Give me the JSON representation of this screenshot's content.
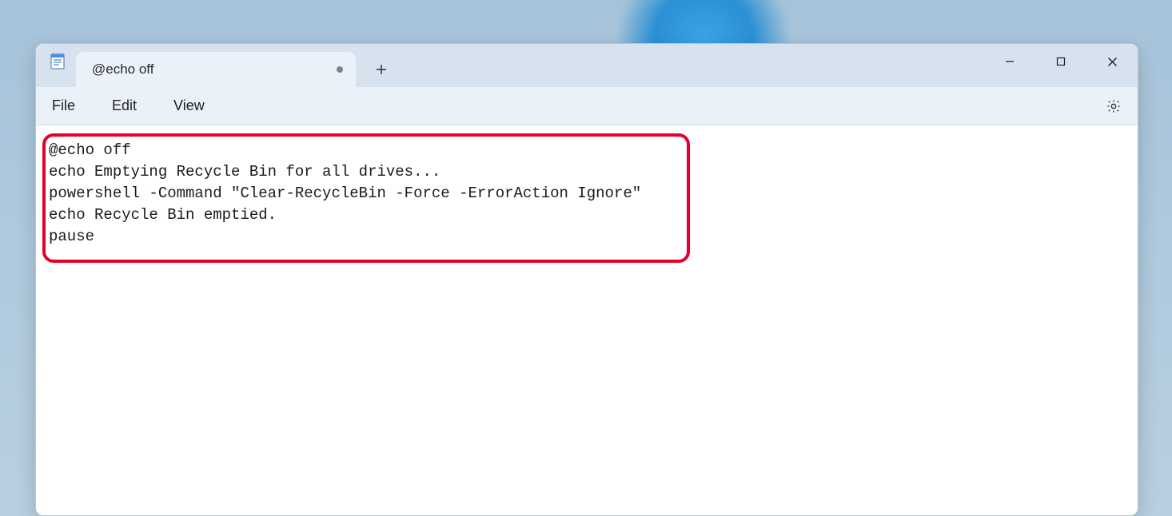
{
  "tab": {
    "title": "@echo off",
    "dirty": true
  },
  "menubar": {
    "file": "File",
    "edit": "Edit",
    "view": "View"
  },
  "editor": {
    "lines": [
      "@echo off",
      "echo Emptying Recycle Bin for all drives...",
      "powershell -Command \"Clear-RecycleBin -Force -ErrorAction Ignore\"",
      "echo Recycle Bin emptied.",
      "pause"
    ]
  },
  "icons": {
    "app": "notepad-icon",
    "new_tab": "plus-icon",
    "minimize": "minimize-icon",
    "maximize": "maximize-icon",
    "close": "close-icon",
    "settings": "gear-icon"
  }
}
